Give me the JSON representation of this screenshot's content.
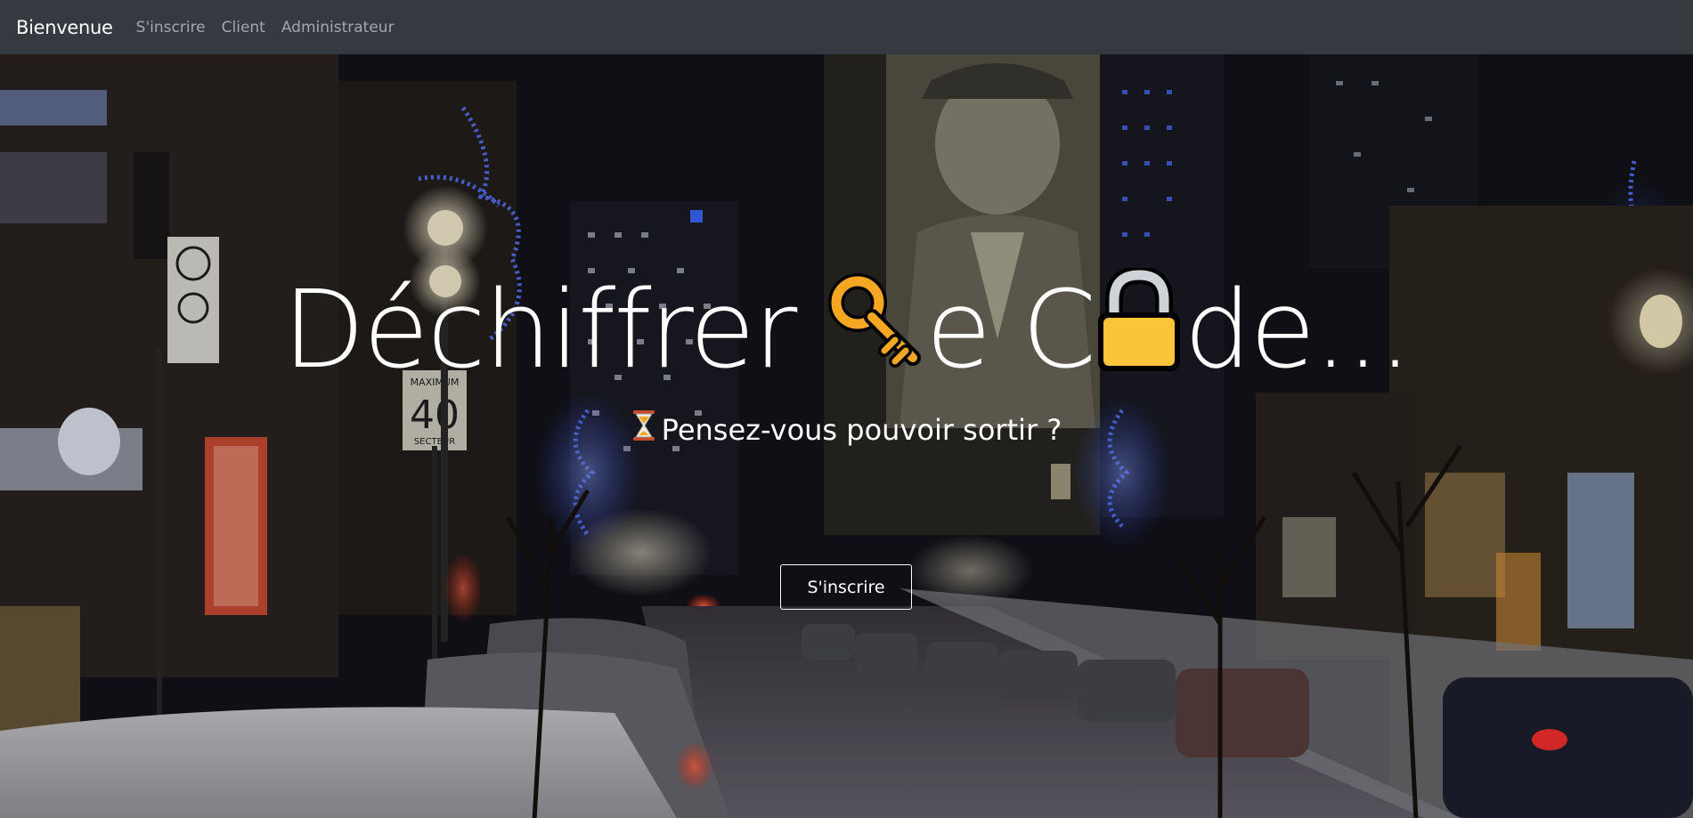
{
  "navbar": {
    "brand": "Bienvenue",
    "links": [
      "S'inscrire",
      "Client",
      "Administrateur"
    ]
  },
  "hero": {
    "title_part1": "Déchiffrer ",
    "title_part2": "e C",
    "title_part3": "de...",
    "subtitle": "Pensez-vous pouvoir sortir ?",
    "cta_label": "S'inscrire",
    "icons": [
      "key-icon",
      "lock-icon",
      "hourglass-icon"
    ]
  },
  "scene_signs": {
    "speed_top": "MAXIMUM",
    "speed_value": "40",
    "speed_bottom": "SECTEUR"
  },
  "colors": {
    "navbar_bg": "#343a40",
    "accent_gold": "#f5a623",
    "lights_blue": "#4a6bff"
  }
}
